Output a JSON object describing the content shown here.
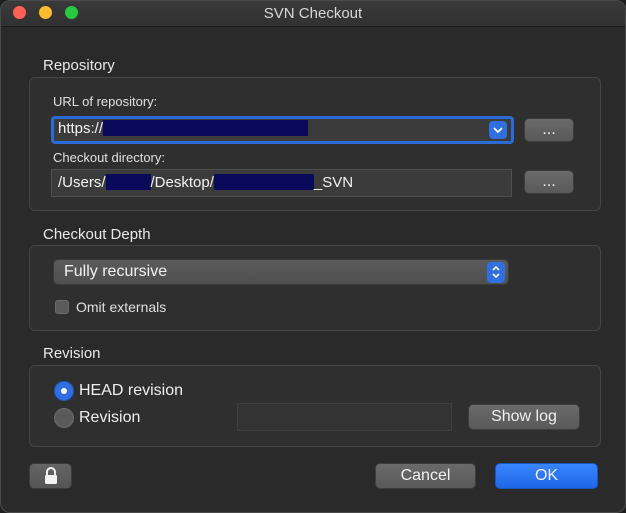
{
  "window": {
    "title": "SVN Checkout"
  },
  "repository": {
    "section_title": "Repository",
    "url_label": "URL of repository:",
    "url_value_prefix": "https://",
    "url_browse_label": "...",
    "checkout_dir_label": "Checkout directory:",
    "checkout_dir_part1": "/Users/",
    "checkout_dir_part2": "/Desktop/",
    "checkout_dir_part3": "_SVN",
    "checkout_browse_label": "..."
  },
  "checkout_depth": {
    "section_title": "Checkout Depth",
    "selected": "Fully recursive",
    "omit_externals_label": "Omit externals",
    "omit_externals_checked": false
  },
  "revision": {
    "section_title": "Revision",
    "head_label": "HEAD revision",
    "revision_label": "Revision",
    "selected": "HEAD revision",
    "revision_value": "",
    "show_log_label": "Show log"
  },
  "footer": {
    "cancel_label": "Cancel",
    "ok_label": "OK"
  },
  "icons": [
    "lock-icon",
    "chevron-down-icon",
    "updown-chevron-icon"
  ],
  "colors": {
    "accent": "#2f6fe0",
    "window_bg": "#2a2a2a",
    "redaction": "#0a0a5a"
  }
}
